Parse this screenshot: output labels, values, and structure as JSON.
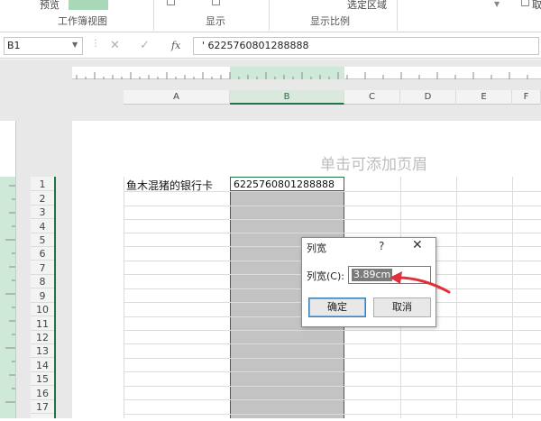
{
  "ribbon": {
    "preview_label": "预览",
    "group_workbook_views": "工作簿视图",
    "group_show": "显示",
    "zoom_selection": "选定区域",
    "group_zoom": "显示比例",
    "cut_checkbox_label": "取"
  },
  "formula_bar": {
    "name_box": "B1",
    "fx_label": "fx",
    "value": "' 6225760801288888"
  },
  "columns": [
    "A",
    "B",
    "C",
    "D",
    "E",
    "F"
  ],
  "rows": [
    "1",
    "2",
    "3",
    "4",
    "5",
    "6",
    "7",
    "8",
    "9",
    "10",
    "11",
    "12",
    "13",
    "14",
    "15",
    "16",
    "17"
  ],
  "page": {
    "header_hint": "单击可添加页眉"
  },
  "cells": {
    "A1": "鱼木混猪的银行卡",
    "B1": "6225760801288888"
  },
  "dialog": {
    "title": "列宽",
    "help": "?",
    "close": "✕",
    "field_label": "列宽(C):",
    "field_value": "3.89cm",
    "ok_label": "确定",
    "cancel_label": "取消"
  },
  "colors": {
    "accent_green": "#217346",
    "selected_column_fill": "#c3c3c3",
    "annotation_arrow": "#e0303a"
  }
}
